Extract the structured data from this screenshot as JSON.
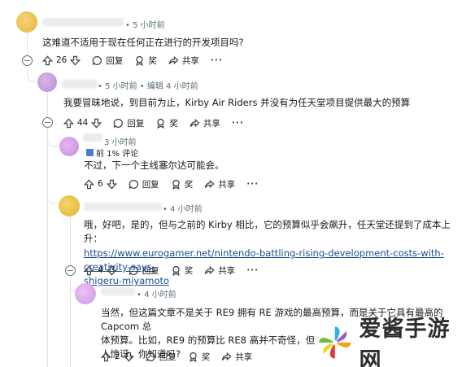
{
  "comments": [
    {
      "id": "c1",
      "time": "• 5 小时前",
      "body": "这难道不适用于现在任何正在进行的开发项目吗?",
      "votes": "26",
      "reply_label": "回复",
      "award_label": "奖",
      "share_label": "共享",
      "collapse_symbol": "−"
    },
    {
      "id": "c2",
      "time": "• 5 小时前 • 编辑 4 小时前",
      "body": "我要冒昧地说，到目前为止，Kirby Air Riders 并没有为任天堂项目提供最大的预算",
      "votes": "44",
      "reply_label": "回复",
      "award_label": "奖",
      "share_label": "共享",
      "collapse_symbol": "−"
    },
    {
      "id": "c3",
      "time": "3 小时前",
      "flair": "前 1% 评论",
      "body": "不过，下一个主线塞尔达可能会。",
      "votes": "6",
      "reply_label": "回复",
      "award_label": "奖",
      "share_label": "共享"
    },
    {
      "id": "c4",
      "time": "• 4 小时前",
      "body": "哦，好吧，是的，但与之前的 Kirby 相比，它的预算似乎会飙升，任天堂还提到了成本上升：",
      "link_line1": "https://www.eurogamer.net/nintendo-battling-rising-development-costs-with-creativity-says-",
      "link_line2": "shigeru-miyamoto",
      "votes": "4",
      "reply_label": "回复",
      "award_label": "奖",
      "share_label": "共享",
      "collapse_symbol": "−"
    },
    {
      "id": "c5",
      "time": "• 4 小时前",
      "body_line1": "当然，但这篇文章不是关于 RE9 拥有 RE 游戏的最高预算，而是关于它具有最高的 Capcom 总",
      "body_line2": "体预算。比如，RE9 的预算比 RE8 高并不奇怪，但我认为",
      "body_line3": "人惊讶，你知道吗?",
      "votes": "2",
      "reply_label": "回复",
      "award_label": "奖",
      "share_label": "共享"
    }
  ],
  "watermark": {
    "text": "爱酱手游网"
  }
}
